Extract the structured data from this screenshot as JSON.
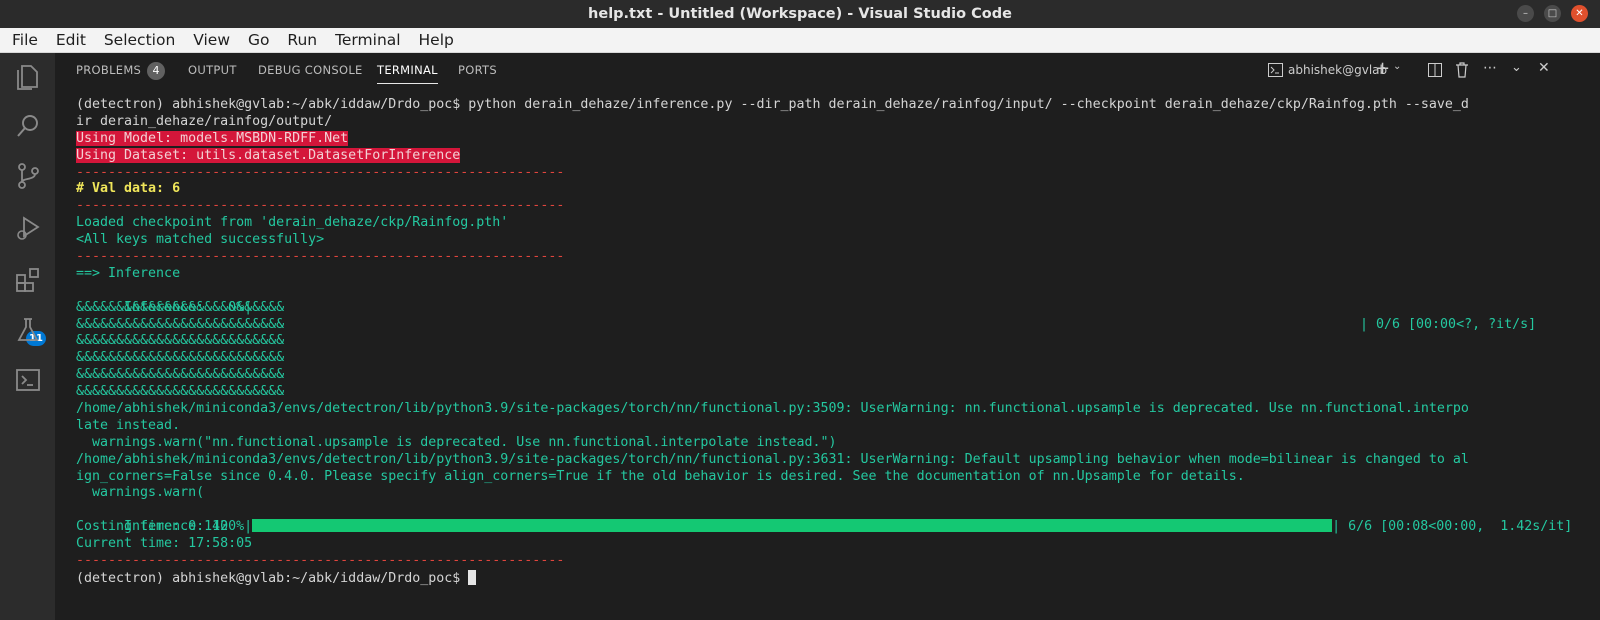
{
  "window": {
    "title": "help.txt - Untitled (Workspace) - Visual Studio Code"
  },
  "menu": [
    "File",
    "Edit",
    "Selection",
    "View",
    "Go",
    "Run",
    "Terminal",
    "Help"
  ],
  "activity_bar": {
    "extensions_badge": "11"
  },
  "panel_tabs": [
    {
      "label": "PROBLEMS",
      "badge": "4"
    },
    {
      "label": "OUTPUT"
    },
    {
      "label": "DEBUG CONSOLE"
    },
    {
      "label": "TERMINAL"
    },
    {
      "label": "PORTS"
    }
  ],
  "terminal_toolbar": {
    "name": "abhishek@gvlab"
  },
  "terminal": {
    "prompt": "(detectron) abhishek@gvlab:~/abk/iddaw/Drdo_poc$ ",
    "command_line1": "(detectron) abhishek@gvlab:~/abk/iddaw/Drdo_poc$ python derain_dehaze/inference.py --dir_path derain_dehaze/rainfog/input/ --checkpoint derain_dehaze/ckp/Rainfog.pth --save_d",
    "command_line2": "ir derain_dehaze/rainfog/output/",
    "model": "Using Model: models.MSBDN-RDFF.Net",
    "dataset": "Using Dataset: utils.dataset.DatasetForInference",
    "separator": "-------------------------------------------------------------",
    "val": "# Val data: 6",
    "loaded": "Loaded checkpoint from 'derain_dehaze/ckp/Rainfog.pth'",
    "keys": "<All keys matched successfully>",
    "inference_header": "==> Inference",
    "progress1_left": "Inference:   0%|",
    "progress1_right": "| 0/6 [00:00<?, ?it/s]",
    "amp_line": "&&&&&&&&&&&&&&&&&&&&&&&&&&",
    "warn1a": "/home/abhishek/miniconda3/envs/detectron/lib/python3.9/site-packages/torch/nn/functional.py:3509: UserWarning: nn.functional.upsample is deprecated. Use nn.functional.interpo",
    "warn1b": "late instead.",
    "warn1c": "  warnings.warn(\"nn.functional.upsample is deprecated. Use nn.functional.interpolate instead.\")",
    "warn2a": "/home/abhishek/miniconda3/envs/detectron/lib/python3.9/site-packages/torch/nn/functional.py:3631: UserWarning: Default upsampling behavior when mode=bilinear is changed to al",
    "warn2b": "ign_corners=False since 0.4.0. Please specify align_corners=True if the old behavior is desired. See the documentation of nn.Upsample for details.",
    "warn2c": "  warnings.warn(",
    "progress2_left": "Inference: 100%|",
    "progress2_right": "| 6/6 [00:08<00:00,  1.42s/it]",
    "progress2_fraction": 1.0,
    "costing": "Costing time: 0.142",
    "current": "Current time: 17:58:05"
  }
}
